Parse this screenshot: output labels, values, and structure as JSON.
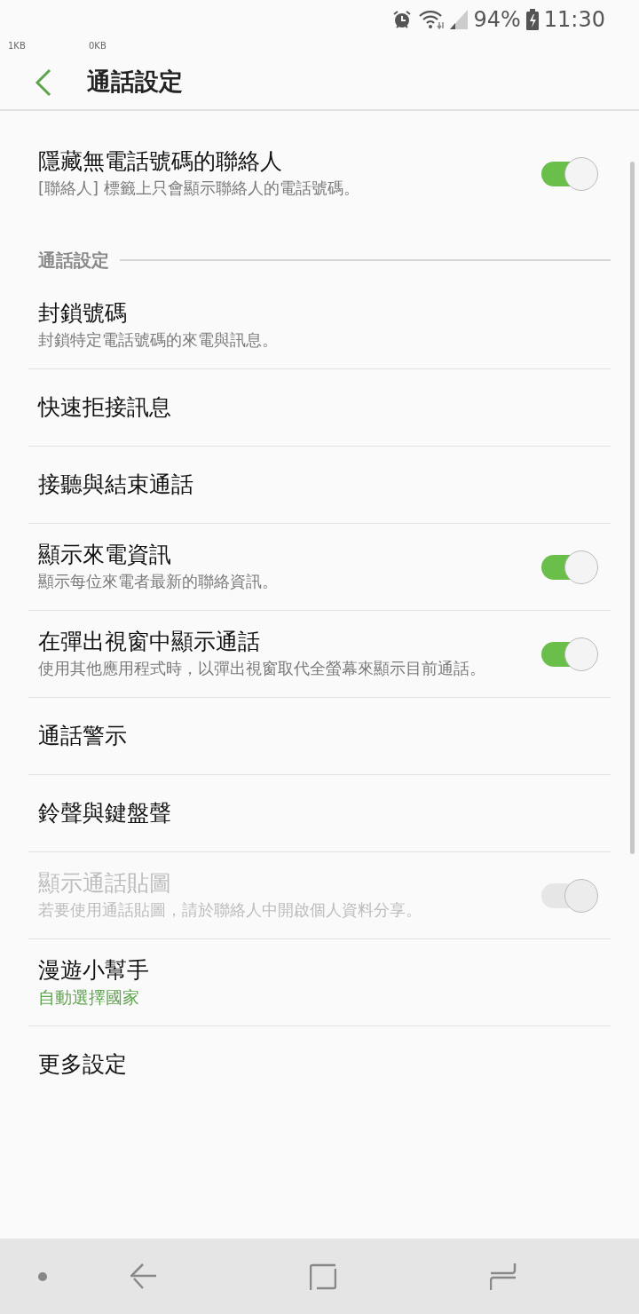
{
  "status_bar": {
    "net_up": "1KB",
    "net_down": "0KB",
    "battery": "94%",
    "time": "11:30"
  },
  "header": {
    "title": "通話設定"
  },
  "items": [
    {
      "kind": "setting",
      "title": "隱藏無電話號碼的聯絡人",
      "subtitle": "[聯絡人] 標籤上只會顯示聯絡人的電話號碼。",
      "switch": {
        "on": true,
        "disabled": false
      }
    },
    {
      "kind": "section",
      "title": "通話設定"
    },
    {
      "kind": "setting",
      "title": "封鎖號碼",
      "subtitle": "封鎖特定電話號碼的來電與訊息。"
    },
    {
      "kind": "setting",
      "title": "快速拒接訊息"
    },
    {
      "kind": "setting",
      "title": "接聽與結束通話"
    },
    {
      "kind": "setting",
      "title": "顯示來電資訊",
      "subtitle": "顯示每位來電者最新的聯絡資訊。",
      "switch": {
        "on": true,
        "disabled": false
      }
    },
    {
      "kind": "setting",
      "title": "在彈出視窗中顯示通話",
      "subtitle": "使用其他應用程式時，以彈出視窗取代全螢幕來顯示目前通話。",
      "switch": {
        "on": true,
        "disabled": false
      }
    },
    {
      "kind": "setting",
      "title": "通話警示"
    },
    {
      "kind": "setting",
      "title": "鈴聲與鍵盤聲"
    },
    {
      "kind": "setting",
      "title": "顯示通話貼圖",
      "subtitle": "若要使用通話貼圖，請於聯絡人中開啟個人資料分享。",
      "disabled": true,
      "switch": {
        "on": true,
        "disabled": true
      }
    },
    {
      "kind": "setting",
      "title": "漫遊小幫手",
      "value": "自動選擇國家"
    },
    {
      "kind": "setting",
      "title": "更多設定"
    }
  ]
}
